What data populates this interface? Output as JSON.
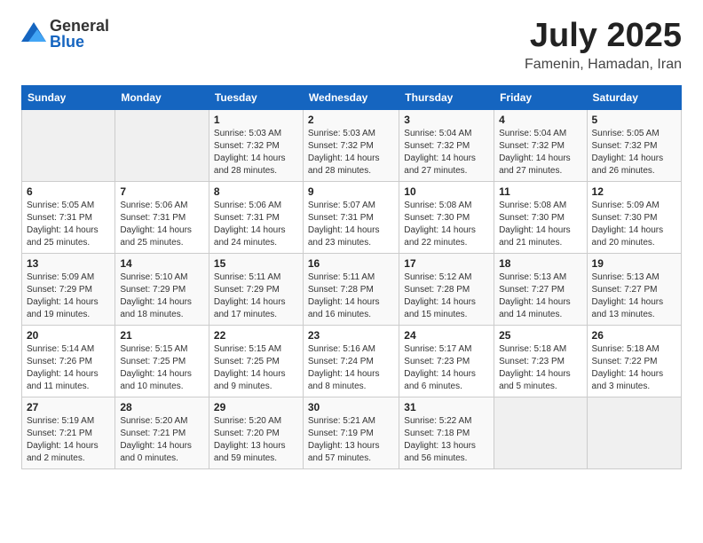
{
  "logo": {
    "general": "General",
    "blue": "Blue"
  },
  "title": "July 2025",
  "location": "Famenin, Hamadan, Iran",
  "days_of_week": [
    "Sunday",
    "Monday",
    "Tuesday",
    "Wednesday",
    "Thursday",
    "Friday",
    "Saturday"
  ],
  "weeks": [
    [
      {
        "day": "",
        "info": ""
      },
      {
        "day": "",
        "info": ""
      },
      {
        "day": "1",
        "info": "Sunrise: 5:03 AM\nSunset: 7:32 PM\nDaylight: 14 hours and 28 minutes."
      },
      {
        "day": "2",
        "info": "Sunrise: 5:03 AM\nSunset: 7:32 PM\nDaylight: 14 hours and 28 minutes."
      },
      {
        "day": "3",
        "info": "Sunrise: 5:04 AM\nSunset: 7:32 PM\nDaylight: 14 hours and 27 minutes."
      },
      {
        "day": "4",
        "info": "Sunrise: 5:04 AM\nSunset: 7:32 PM\nDaylight: 14 hours and 27 minutes."
      },
      {
        "day": "5",
        "info": "Sunrise: 5:05 AM\nSunset: 7:32 PM\nDaylight: 14 hours and 26 minutes."
      }
    ],
    [
      {
        "day": "6",
        "info": "Sunrise: 5:05 AM\nSunset: 7:31 PM\nDaylight: 14 hours and 25 minutes."
      },
      {
        "day": "7",
        "info": "Sunrise: 5:06 AM\nSunset: 7:31 PM\nDaylight: 14 hours and 25 minutes."
      },
      {
        "day": "8",
        "info": "Sunrise: 5:06 AM\nSunset: 7:31 PM\nDaylight: 14 hours and 24 minutes."
      },
      {
        "day": "9",
        "info": "Sunrise: 5:07 AM\nSunset: 7:31 PM\nDaylight: 14 hours and 23 minutes."
      },
      {
        "day": "10",
        "info": "Sunrise: 5:08 AM\nSunset: 7:30 PM\nDaylight: 14 hours and 22 minutes."
      },
      {
        "day": "11",
        "info": "Sunrise: 5:08 AM\nSunset: 7:30 PM\nDaylight: 14 hours and 21 minutes."
      },
      {
        "day": "12",
        "info": "Sunrise: 5:09 AM\nSunset: 7:30 PM\nDaylight: 14 hours and 20 minutes."
      }
    ],
    [
      {
        "day": "13",
        "info": "Sunrise: 5:09 AM\nSunset: 7:29 PM\nDaylight: 14 hours and 19 minutes."
      },
      {
        "day": "14",
        "info": "Sunrise: 5:10 AM\nSunset: 7:29 PM\nDaylight: 14 hours and 18 minutes."
      },
      {
        "day": "15",
        "info": "Sunrise: 5:11 AM\nSunset: 7:29 PM\nDaylight: 14 hours and 17 minutes."
      },
      {
        "day": "16",
        "info": "Sunrise: 5:11 AM\nSunset: 7:28 PM\nDaylight: 14 hours and 16 minutes."
      },
      {
        "day": "17",
        "info": "Sunrise: 5:12 AM\nSunset: 7:28 PM\nDaylight: 14 hours and 15 minutes."
      },
      {
        "day": "18",
        "info": "Sunrise: 5:13 AM\nSunset: 7:27 PM\nDaylight: 14 hours and 14 minutes."
      },
      {
        "day": "19",
        "info": "Sunrise: 5:13 AM\nSunset: 7:27 PM\nDaylight: 14 hours and 13 minutes."
      }
    ],
    [
      {
        "day": "20",
        "info": "Sunrise: 5:14 AM\nSunset: 7:26 PM\nDaylight: 14 hours and 11 minutes."
      },
      {
        "day": "21",
        "info": "Sunrise: 5:15 AM\nSunset: 7:25 PM\nDaylight: 14 hours and 10 minutes."
      },
      {
        "day": "22",
        "info": "Sunrise: 5:15 AM\nSunset: 7:25 PM\nDaylight: 14 hours and 9 minutes."
      },
      {
        "day": "23",
        "info": "Sunrise: 5:16 AM\nSunset: 7:24 PM\nDaylight: 14 hours and 8 minutes."
      },
      {
        "day": "24",
        "info": "Sunrise: 5:17 AM\nSunset: 7:23 PM\nDaylight: 14 hours and 6 minutes."
      },
      {
        "day": "25",
        "info": "Sunrise: 5:18 AM\nSunset: 7:23 PM\nDaylight: 14 hours and 5 minutes."
      },
      {
        "day": "26",
        "info": "Sunrise: 5:18 AM\nSunset: 7:22 PM\nDaylight: 14 hours and 3 minutes."
      }
    ],
    [
      {
        "day": "27",
        "info": "Sunrise: 5:19 AM\nSunset: 7:21 PM\nDaylight: 14 hours and 2 minutes."
      },
      {
        "day": "28",
        "info": "Sunrise: 5:20 AM\nSunset: 7:21 PM\nDaylight: 14 hours and 0 minutes."
      },
      {
        "day": "29",
        "info": "Sunrise: 5:20 AM\nSunset: 7:20 PM\nDaylight: 13 hours and 59 minutes."
      },
      {
        "day": "30",
        "info": "Sunrise: 5:21 AM\nSunset: 7:19 PM\nDaylight: 13 hours and 57 minutes."
      },
      {
        "day": "31",
        "info": "Sunrise: 5:22 AM\nSunset: 7:18 PM\nDaylight: 13 hours and 56 minutes."
      },
      {
        "day": "",
        "info": ""
      },
      {
        "day": "",
        "info": ""
      }
    ]
  ]
}
